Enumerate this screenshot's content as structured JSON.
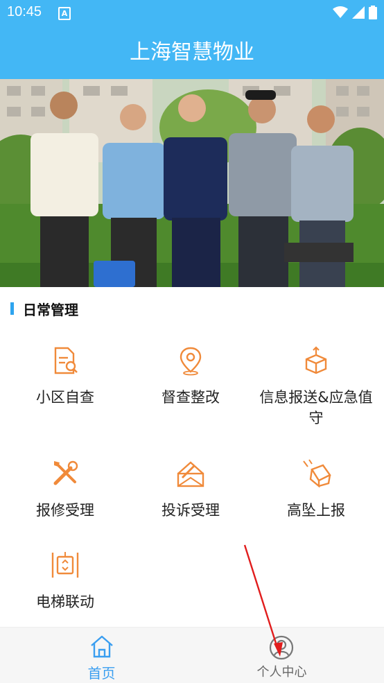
{
  "status_bar": {
    "time": "10:45",
    "notification_glyph": "A"
  },
  "header": {
    "title": "上海智慧物业"
  },
  "section": {
    "title": "日常管理"
  },
  "grid": [
    {
      "label": "小区自查",
      "icon": "document-search-icon"
    },
    {
      "label": "督查整改",
      "icon": "location-pin-icon"
    },
    {
      "label": "信息报送&应急值守",
      "icon": "box-upload-icon"
    },
    {
      "label": "报修受理",
      "icon": "tools-icon"
    },
    {
      "label": "投诉受理",
      "icon": "envelope-edit-icon"
    },
    {
      "label": "高坠上报",
      "icon": "falling-box-icon"
    },
    {
      "label": "电梯联动",
      "icon": "elevator-icon"
    }
  ],
  "bottom_nav": {
    "home": {
      "label": "首页",
      "active": true
    },
    "profile": {
      "label": "个人中心",
      "active": false
    }
  },
  "colors": {
    "primary": "#43b7f5",
    "accent_orange": "#f08a3a",
    "tab_active": "#3a9ef0",
    "tab_inactive": "#666666",
    "annotation_arrow": "#e11d1d"
  }
}
